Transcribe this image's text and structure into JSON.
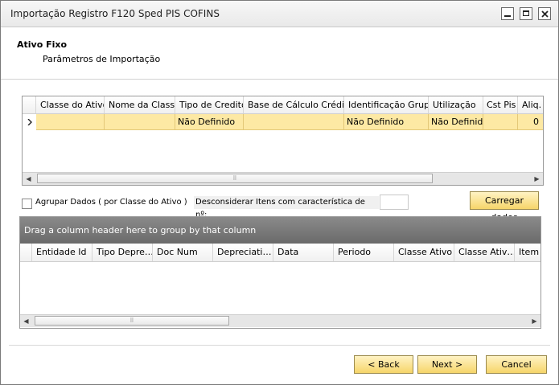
{
  "window": {
    "title": "Importação Registro F120 Sped PIS COFINS"
  },
  "header": {
    "title": "Ativo Fixo",
    "subtitle": "Parâmetros de Importação"
  },
  "grid_top": {
    "columns": [
      "Classe do Ativo",
      "Nome da Classe",
      "Tipo de Credito",
      "Base de Cálculo Crédito",
      "Identificação Grupo",
      "Utilização",
      "Cst Pis",
      "Aliq."
    ],
    "row": [
      "",
      "",
      "Não Definido",
      "",
      "Não Definido",
      "Não Definido",
      "",
      "0"
    ]
  },
  "options": {
    "group_checkbox_label": "Agrupar Dados ( por Classe do Ativo )",
    "group_checked": false,
    "ignore_label": "Desconsiderar Itens com característica de nº:",
    "ignore_value": "",
    "load_button": "Carregar dados"
  },
  "grid_bottom": {
    "group_hint": "Drag a column header here to group by that column",
    "columns": [
      "Entidade Id",
      "Tipo Depre…",
      "Doc Num",
      "Depreciati…",
      "Data",
      "Periodo",
      "Classe Ativo",
      "Classe Ativ…",
      "Item"
    ]
  },
  "footer": {
    "back": "< Back",
    "next": "Next >",
    "cancel": "Cancel"
  },
  "colors": {
    "row_highlight": "#fde9a4",
    "button_yellow": "#f6d56a",
    "group_bar": "#7a7a7a"
  },
  "icons": {
    "minimize": "minimize-icon",
    "maximize": "maximize-icon",
    "close": "close-icon",
    "row_pointer": "row-pointer-icon"
  }
}
